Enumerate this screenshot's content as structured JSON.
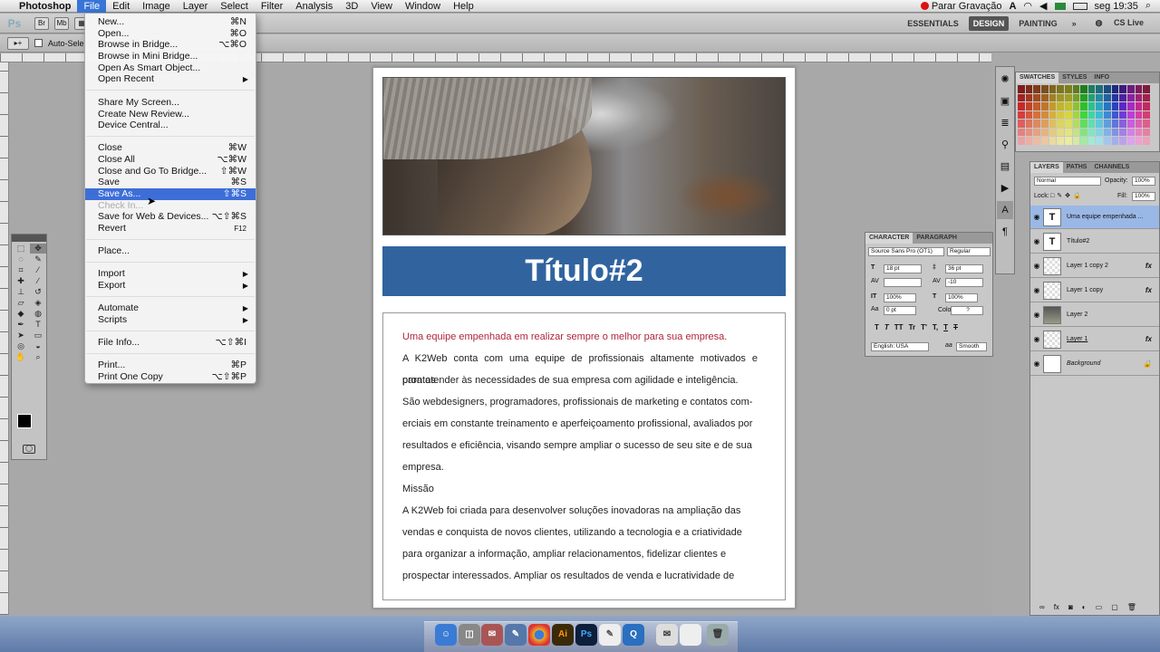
{
  "menubar": {
    "apple": "",
    "app": "Photoshop",
    "items": [
      "File",
      "Edit",
      "Image",
      "Layer",
      "Select",
      "Filter",
      "Analysis",
      "3D",
      "View",
      "Window",
      "Help"
    ],
    "recording": "Parar Gravação",
    "clock": "seg 19:35"
  },
  "appbar": {
    "workspaces": [
      "ESSENTIALS",
      "DESIGN",
      "PAINTING"
    ],
    "cs_live": "CS Live"
  },
  "options": {
    "auto_select": "Auto-Select:"
  },
  "file_menu": {
    "items": [
      {
        "label": "New...",
        "shortcut": "⌘N"
      },
      {
        "label": "Open...",
        "shortcut": "⌘O"
      },
      {
        "label": "Browse in Bridge...",
        "shortcut": "⌥⌘O"
      },
      {
        "label": "Browse in Mini Bridge...",
        "shortcut": ""
      },
      {
        "label": "Open As Smart Object...",
        "shortcut": ""
      },
      {
        "label": "Open Recent",
        "shortcut": ""
      },
      {
        "label": "Share My Screen...",
        "shortcut": ""
      },
      {
        "label": "Create New Review...",
        "shortcut": ""
      },
      {
        "label": "Device Central...",
        "shortcut": ""
      },
      {
        "label": "Close",
        "shortcut": "⌘W"
      },
      {
        "label": "Close All",
        "shortcut": "⌥⌘W"
      },
      {
        "label": "Close and Go To Bridge...",
        "shortcut": "⇧⌘W"
      },
      {
        "label": "Save",
        "shortcut": "⌘S"
      },
      {
        "label": "Save As...",
        "shortcut": "⇧⌘S"
      },
      {
        "label": "Check In...",
        "shortcut": ""
      },
      {
        "label": "Save for Web & Devices...",
        "shortcut": "⌥⇧⌘S"
      },
      {
        "label": "Revert",
        "shortcut": "F12"
      },
      {
        "label": "Place...",
        "shortcut": ""
      },
      {
        "label": "Import",
        "shortcut": ""
      },
      {
        "label": "Export",
        "shortcut": ""
      },
      {
        "label": "Automate",
        "shortcut": ""
      },
      {
        "label": "Scripts",
        "shortcut": ""
      },
      {
        "label": "File Info...",
        "shortcut": "⌥⇧⌘I"
      },
      {
        "label": "Print...",
        "shortcut": "⌘P"
      },
      {
        "label": "Print One Copy",
        "shortcut": "⌥⇧⌘P"
      }
    ]
  },
  "document": {
    "title": "Título#2",
    "paragraphs": [
      "Uma equipe empenhada em realizar sempre o melhor para sua empresa.",
      "A K2Web conta com uma equipe de profissionais altamente motivados e prontos",
      "para atender às necessidades de sua empresa com agilidade e inteligência.",
      "São webdesigners, programadores, profissionais de marketing e contatos com-",
      "erciais em constante treinamento e aperfeiçoamento profissional, avaliados por",
      "resultados e eficiência, visando sempre ampliar o sucesso de seu site e de sua",
      "empresa.",
      "Missão",
      "A K2Web foi criada para desenvolver soluções inovadoras na ampliação das",
      "vendas e conquista de novos clientes, utilizando a tecnologia e a criatividade",
      "para organizar a informação, ampliar relacionamentos, fidelizar clientes e",
      "prospectar interessados. Ampliar os resultados de venda e lucratividade de"
    ]
  },
  "swatches_panel": {
    "tabs": [
      "SWATCHES",
      "STYLES",
      "INFO"
    ]
  },
  "layers_panel": {
    "tabs": [
      "LAYERS",
      "PATHS",
      "CHANNELS"
    ],
    "blend_mode": "Normal",
    "opacity_label": "Opacity:",
    "opacity": "100%",
    "lock_label": "Lock:",
    "fill_label": "Fill:",
    "fill": "100%",
    "layers": [
      {
        "name": "Uma equipe empenhada ...",
        "thumb": "T",
        "fx": ""
      },
      {
        "name": "Título#2",
        "thumb": "T",
        "fx": ""
      },
      {
        "name": "Layer 1 copy 2",
        "thumb": "",
        "fx": "fx"
      },
      {
        "name": "Layer 1 copy",
        "thumb": "",
        "fx": "fx"
      },
      {
        "name": "Layer 2",
        "thumb": "",
        "fx": ""
      },
      {
        "name": "Layer 1",
        "thumb": "",
        "fx": "fx"
      },
      {
        "name": "Background",
        "thumb": "",
        "fx": ""
      }
    ]
  },
  "character_panel": {
    "tabs": [
      "CHARACTER",
      "PARAGRAPH"
    ],
    "font": "Source Sans Pro (OT1)",
    "style": "Regular",
    "size": "18 pt",
    "leading": "36 pt",
    "kerning": "",
    "tracking": "-10",
    "vscale": "100%",
    "hscale": "100%",
    "baseline": "0 pt",
    "color_label": "Color:",
    "color_value": "?",
    "language": "English: USA",
    "aa_label": "aa",
    "antialias": "Smooth",
    "styles": [
      "T",
      "T",
      "TT",
      "Tr",
      "T'",
      "T,",
      "T",
      "T"
    ]
  }
}
